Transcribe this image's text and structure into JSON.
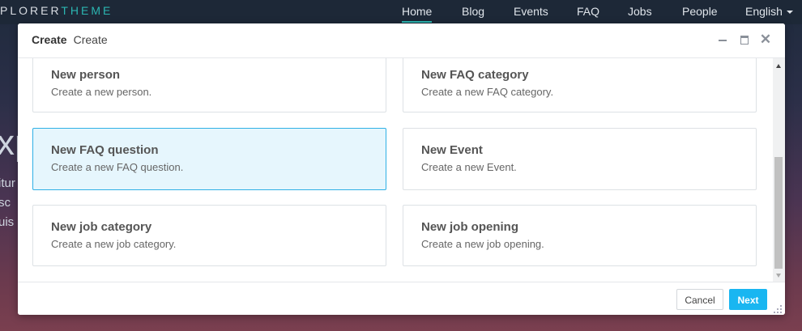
{
  "site": {
    "brand_main": "PLORER",
    "brand_accent": "THEME",
    "nav": [
      "Home",
      "Blog",
      "Events",
      "FAQ",
      "Jobs",
      "People",
      "English"
    ],
    "hero_big": "xp",
    "hero_lines": [
      "itur",
      "sc",
      "uis"
    ]
  },
  "modal": {
    "title": "Create",
    "subtitle": "Create",
    "cards": [
      {
        "title": "New person",
        "desc": "Create a new person."
      },
      {
        "title": "New FAQ category",
        "desc": "Create a new FAQ category."
      },
      {
        "title": "New FAQ question",
        "desc": "Create a new FAQ question.",
        "selected": true
      },
      {
        "title": "New Event",
        "desc": "Create a new Event."
      },
      {
        "title": "New job category",
        "desc": "Create a new job category."
      },
      {
        "title": "New job opening",
        "desc": "Create a new job opening."
      }
    ],
    "cancel_label": "Cancel",
    "next_label": "Next",
    "window_controls": [
      "minimize-icon",
      "maximize-icon",
      "close-icon"
    ]
  },
  "colors": {
    "accent": "#19b6f1",
    "selected_bg": "#e6f6fd",
    "brand_teal": "#2bb5b1"
  }
}
